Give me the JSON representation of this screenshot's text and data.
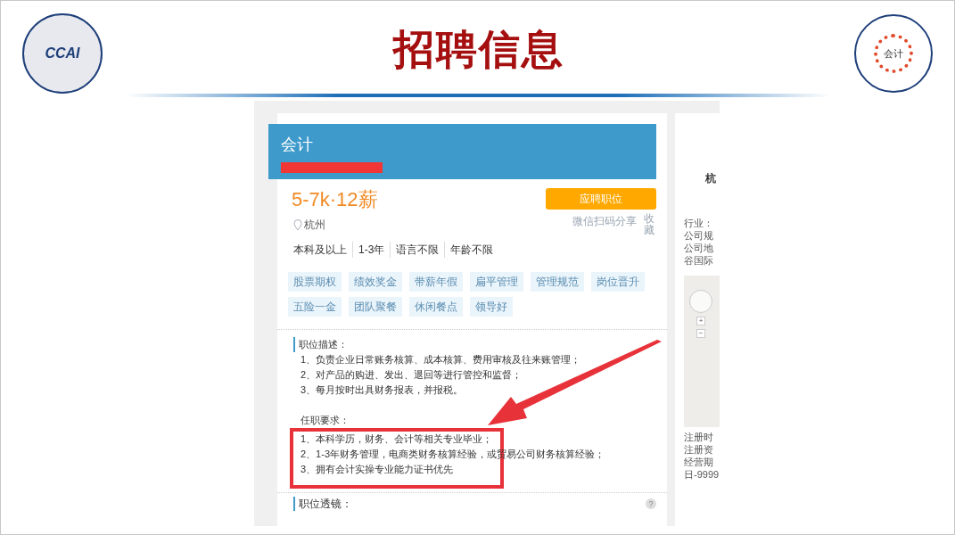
{
  "slide": {
    "title": "招聘信息",
    "left_logo": {
      "text": "CCAI"
    },
    "right_logo": {
      "text": "会计"
    }
  },
  "job": {
    "title": "会计",
    "salary": "5-7k·12薪",
    "apply_button": "应聘职位",
    "share": "微信扫码分享",
    "favorite": "收藏",
    "location": "杭州",
    "requirements": [
      "本科及以上",
      "1-3年",
      "语言不限",
      "年龄不限"
    ],
    "tags": [
      "股票期权",
      "绩效奖金",
      "带薪年假",
      "扁平管理",
      "管理规范",
      "岗位晋升",
      "五险一金",
      "团队聚餐",
      "休闲餐点",
      "领导好"
    ],
    "description": {
      "heading": "职位描述：",
      "lines": [
        "1、负责企业日常账务核算、成本核算、费用审核及往来账管理；",
        "2、对产品的购进、发出、退回等进行管控和监督；",
        "3、每月按时出具财务报表，并报税。"
      ]
    },
    "qualifications": {
      "heading": "任职要求：",
      "lines": [
        "1、本科学历，财务、会计等相关专业毕业；",
        "2、1-3年财务管理，电商类财务核算经验，或贸易公司财务核算经验；",
        "3、拥有会计实操专业能力证书优先"
      ]
    },
    "lens": {
      "heading": "职位透镜：",
      "help": "?"
    }
  },
  "company_panel": {
    "name": "杭",
    "info": [
      "行业：",
      "公司规",
      "公司地",
      "谷国际"
    ],
    "map_buttons": [
      "+",
      "−"
    ],
    "registration": [
      "注册时",
      "注册资",
      "经营期",
      "日-9999"
    ]
  }
}
